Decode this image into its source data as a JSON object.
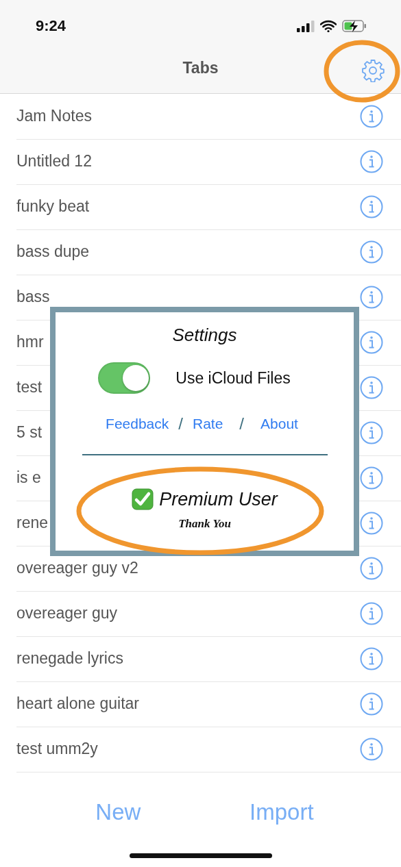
{
  "status_bar": {
    "time": "9:24"
  },
  "nav_bar": {
    "title": "Tabs"
  },
  "tabs": [
    {
      "name": "Jam Notes"
    },
    {
      "name": "Untitled 12"
    },
    {
      "name": "funky beat"
    },
    {
      "name": "bass dupe"
    },
    {
      "name": "bass"
    },
    {
      "name": "hmr"
    },
    {
      "name": "test"
    },
    {
      "name": "5 st"
    },
    {
      "name": "is e"
    },
    {
      "name": "rene"
    },
    {
      "name": "overeager guy v2"
    },
    {
      "name": "overeager guy"
    },
    {
      "name": "renegade lyrics"
    },
    {
      "name": "heart alone guitar"
    },
    {
      "name": "test umm2y"
    }
  ],
  "settings": {
    "title": "Settings",
    "icloud_toggle": {
      "label": "Use iCloud Files",
      "on": true
    },
    "links": [
      {
        "kind": "link",
        "text": "Feedback"
      },
      {
        "kind": "separator",
        "text": "/"
      },
      {
        "kind": "link",
        "text": "Rate"
      },
      {
        "kind": "separator",
        "text": "/"
      },
      {
        "kind": "link",
        "text": "About"
      }
    ],
    "premium": {
      "checked": true,
      "label": "Premium User",
      "note": "Thank You"
    }
  },
  "bottom_buttons": [
    "New",
    "Import"
  ]
}
